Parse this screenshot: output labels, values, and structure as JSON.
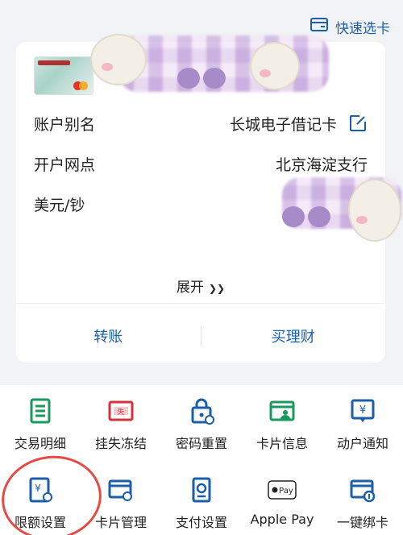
{
  "header": {
    "quick_select": "快速选卡",
    "quick_select_icon": "card-switch-icon"
  },
  "card": {
    "rows": [
      {
        "label": "账户别名",
        "value": "长城电子借记卡"
      },
      {
        "label": "开户网点",
        "value": "北京海淀支行"
      },
      {
        "label": "美元/钞",
        "value": ""
      }
    ],
    "expand_label": "展开",
    "expand_icon": "double-chevron-down-icon",
    "actions": [
      {
        "label": "转账"
      },
      {
        "label": "买理财"
      }
    ]
  },
  "services": [
    {
      "label": "交易明细",
      "icon": "transaction-detail-icon",
      "color": "#1a9a5a"
    },
    {
      "label": "挂失冻结",
      "icon": "report-loss-icon",
      "color": "#d6303a"
    },
    {
      "label": "密码重置",
      "icon": "password-lock-icon",
      "color": "#1b5fa8"
    },
    {
      "label": "卡片信息",
      "icon": "card-info-icon",
      "color": "#1a9a5a"
    },
    {
      "label": "动户通知",
      "icon": "account-notice-icon",
      "color": "#1b5fa8"
    },
    {
      "label": "限额设置",
      "icon": "limit-setting-icon",
      "color": "#1b5fa8"
    },
    {
      "label": "卡片管理",
      "icon": "card-manage-icon",
      "color": "#1b5fa8"
    },
    {
      "label": "支付设置",
      "icon": "payment-setting-icon",
      "color": "#1b5fa8"
    },
    {
      "label": "Apple Pay",
      "icon": "apple-pay-icon",
      "color": "#222222",
      "badge": "Pay"
    },
    {
      "label": "一键绑卡",
      "icon": "one-click-bind-icon",
      "color": "#1b5fa8"
    }
  ],
  "colors": {
    "accent": "#1b5fa8",
    "annotation": "#e64a45"
  }
}
